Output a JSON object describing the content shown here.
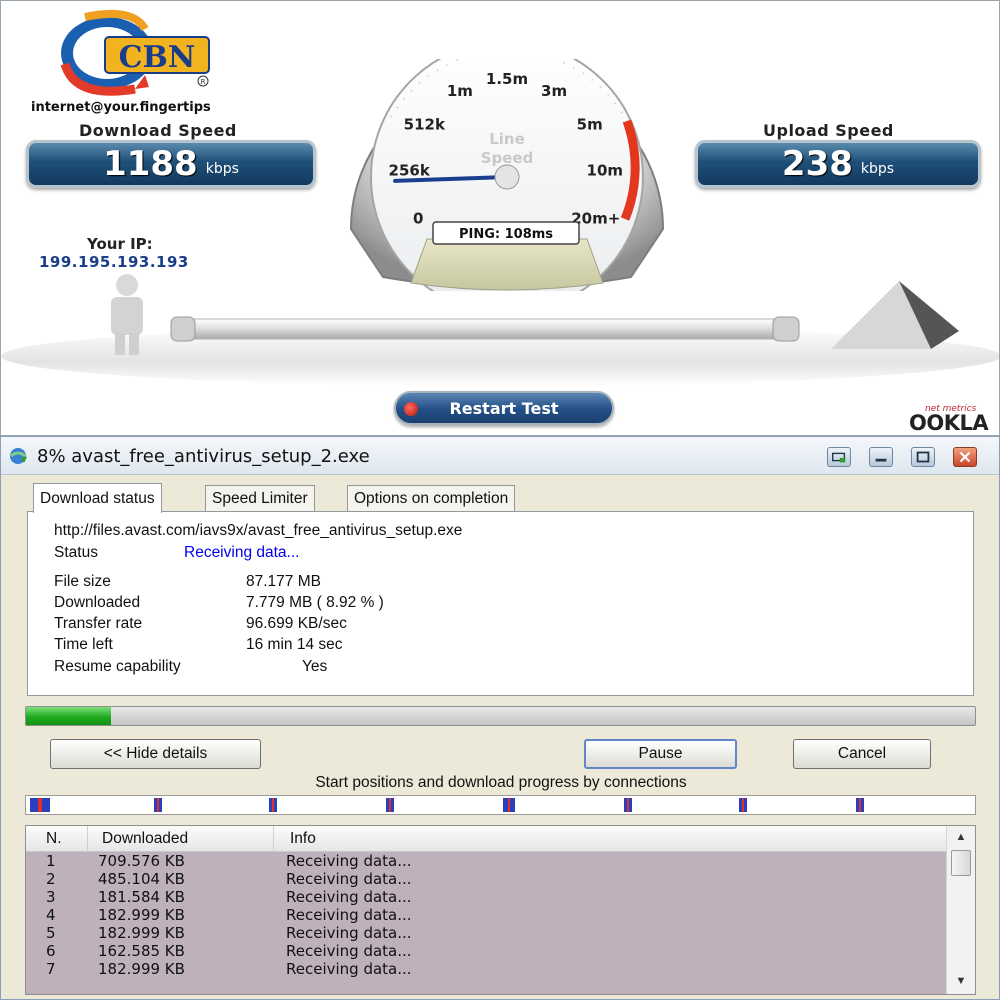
{
  "speedtest": {
    "logo_text": "CBN",
    "tagline": "internet@your.fingertips",
    "download_label": "Download Speed",
    "download_value": "1188",
    "download_unit": "kbps",
    "upload_label": "Upload Speed",
    "upload_value": "238",
    "upload_unit": "kbps",
    "ip_label": "Your IP:",
    "ip_value": "199.195.193.193",
    "gauge": {
      "center_label_1": "Line",
      "center_label_2": "Speed",
      "ticks": [
        "0",
        "256k",
        "512k",
        "1m",
        "1.5m",
        "3m",
        "5m",
        "10m",
        "20m+"
      ],
      "needle_position": "0.1",
      "ping_text": "PING: 108ms"
    },
    "restart_label": "Restart Test",
    "brand_sub": "net metrics",
    "brand": "OOKLA"
  },
  "dialog": {
    "title": "8% avast_free_antivirus_setup_2.exe",
    "tabs": [
      "Download status",
      "Speed Limiter",
      "Options on completion"
    ],
    "url": "http://files.avast.com/iavs9x/avast_free_antivirus_setup.exe",
    "status_label": "Status",
    "status_value": "Receiving data...",
    "fields": [
      {
        "label": "File size",
        "value": "87.177  MB"
      },
      {
        "label": "Downloaded",
        "value": "7.779  MB  ( 8.92 % )"
      },
      {
        "label": "Transfer rate",
        "value": "96.699  KB/sec"
      },
      {
        "label": "Time left",
        "value": "16 min 14 sec"
      }
    ],
    "resume_label": "Resume capability",
    "resume_value": "Yes",
    "progress_percent": 8.92,
    "hide_details_label": "<< Hide details",
    "pause_label": "Pause",
    "cancel_label": "Cancel",
    "connections_caption": "Start positions and download progress by connections",
    "columns": [
      "N.",
      "Downloaded",
      "Info"
    ],
    "rows": [
      {
        "n": "1",
        "downloaded": "709.576  KB",
        "info": "Receiving data..."
      },
      {
        "n": "2",
        "downloaded": "485.104  KB",
        "info": "Receiving data..."
      },
      {
        "n": "3",
        "downloaded": "181.584  KB",
        "info": "Receiving data..."
      },
      {
        "n": "4",
        "downloaded": "182.999  KB",
        "info": "Receiving data..."
      },
      {
        "n": "5",
        "downloaded": "182.999  KB",
        "info": "Receiving data..."
      },
      {
        "n": "6",
        "downloaded": "162.585  KB",
        "info": "Receiving data..."
      },
      {
        "n": "7",
        "downloaded": "182.999  KB",
        "info": "Receiving data..."
      }
    ],
    "colors": {
      "progress": "#1faa1f",
      "list_bg": "#bfb1bb",
      "status": "#0000ee"
    }
  }
}
